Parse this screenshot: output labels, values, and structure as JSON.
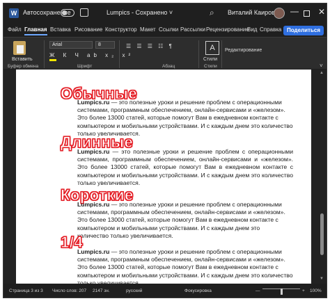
{
  "titlebar": {
    "app_logo": "W",
    "autosave_label": "Автосохранение",
    "autosave_state": "on",
    "doc_title": "Lumpics  -  Сохранено ˅",
    "user_name": "Виталий Каиров",
    "icons": [
      "save-icon",
      "search-icon",
      "minimize-icon",
      "maximize-icon",
      "close-icon"
    ],
    "search_glyph": "⌕",
    "min_glyph": "—",
    "close_glyph": "✕"
  },
  "tabs": [
    {
      "label": "Файл"
    },
    {
      "label": "Главная",
      "active": true
    },
    {
      "label": "Вставка"
    },
    {
      "label": "Рисование"
    },
    {
      "label": "Конструктор"
    },
    {
      "label": "Макет"
    },
    {
      "label": "Ссылки"
    },
    {
      "label": "Рассылки"
    },
    {
      "label": "Рецензирование"
    },
    {
      "label": "Вид"
    },
    {
      "label": "Справка"
    }
  ],
  "share_button": "Поделиться",
  "ribbon": {
    "paste_label": "Вставить",
    "font_name": "Arial",
    "font_size": "8",
    "format_glyphs": "Ж К Ч  ab x₂ x²",
    "para_glyphs_1": "☰ ☰ ☰ ☷ ¶",
    "styles_label": "Стили",
    "styles_glyph": "A",
    "editing_label": "Редактирование",
    "groups": {
      "clipboard": "Буфер обмена",
      "font": "Шрифт",
      "paragraph": "Абзац",
      "styles": "Стили"
    },
    "colors": {
      "highlight": "#f2e600",
      "font_color": "#e41c24"
    },
    "chevron_glyph": "˅"
  },
  "document": {
    "headings": {
      "normal": "Обычные",
      "long": "Длинные",
      "short": "Короткие",
      "quarter": "1/4"
    },
    "paragraphs": [
      {
        "bold": "Lumpics.ru",
        "text": " — это полезные уроки и решение проблем с операционными системами, программным обеспечением, онлайн-сервисами и «железом». Это более 13000 статей, которые помогут Вам в ежедневном контакте с компьютером и мобильными устройствами. И с каждым днем это количество только увеличивается."
      },
      {
        "bold": "Lumpics.ru",
        "text": " — это полезные уроки и решение проблем с операционными системами, программным обеспечением, онлайн-сервисами и «железом». Это более 13000 статей, которые помогут Вам в ежедневном контакте с компьютером и мобильными устройствами. И с каждым днем это количество только увеличивается."
      },
      {
        "bold": "Lumpics.ru",
        "text": " — это полезные уроки и решение проблем с операционными системами, программным обеспечением, онлайн-сервисами и «железом». Это более 13000 статей, которые помогут Вам в ежедневном контакте с компьютером и мобильными устройствами. И с каждым днем это количество только увеличивается."
      },
      {
        "bold": "Lumpics.ru",
        "text": " — это полезные уроки и решение проблем с операционными системами, программным обеспечением, онлайн-сервисами и «железом». Это более 13000 статей, которые помогут Вам в ежедневном контакте с компьютером и мобильными устройствами. И с каждым днем это количество только увеличивается."
      }
    ],
    "heading_color": "#e41c24"
  },
  "statusbar": {
    "page_info": "Страница 3 из 3",
    "word_count": "Число слов: 207",
    "char_count": "2147 зн.",
    "language": "русский",
    "focus_mode": "Фокусировка",
    "zoom_minus": "—",
    "zoom_plus": "+",
    "zoom_level": "100%"
  }
}
